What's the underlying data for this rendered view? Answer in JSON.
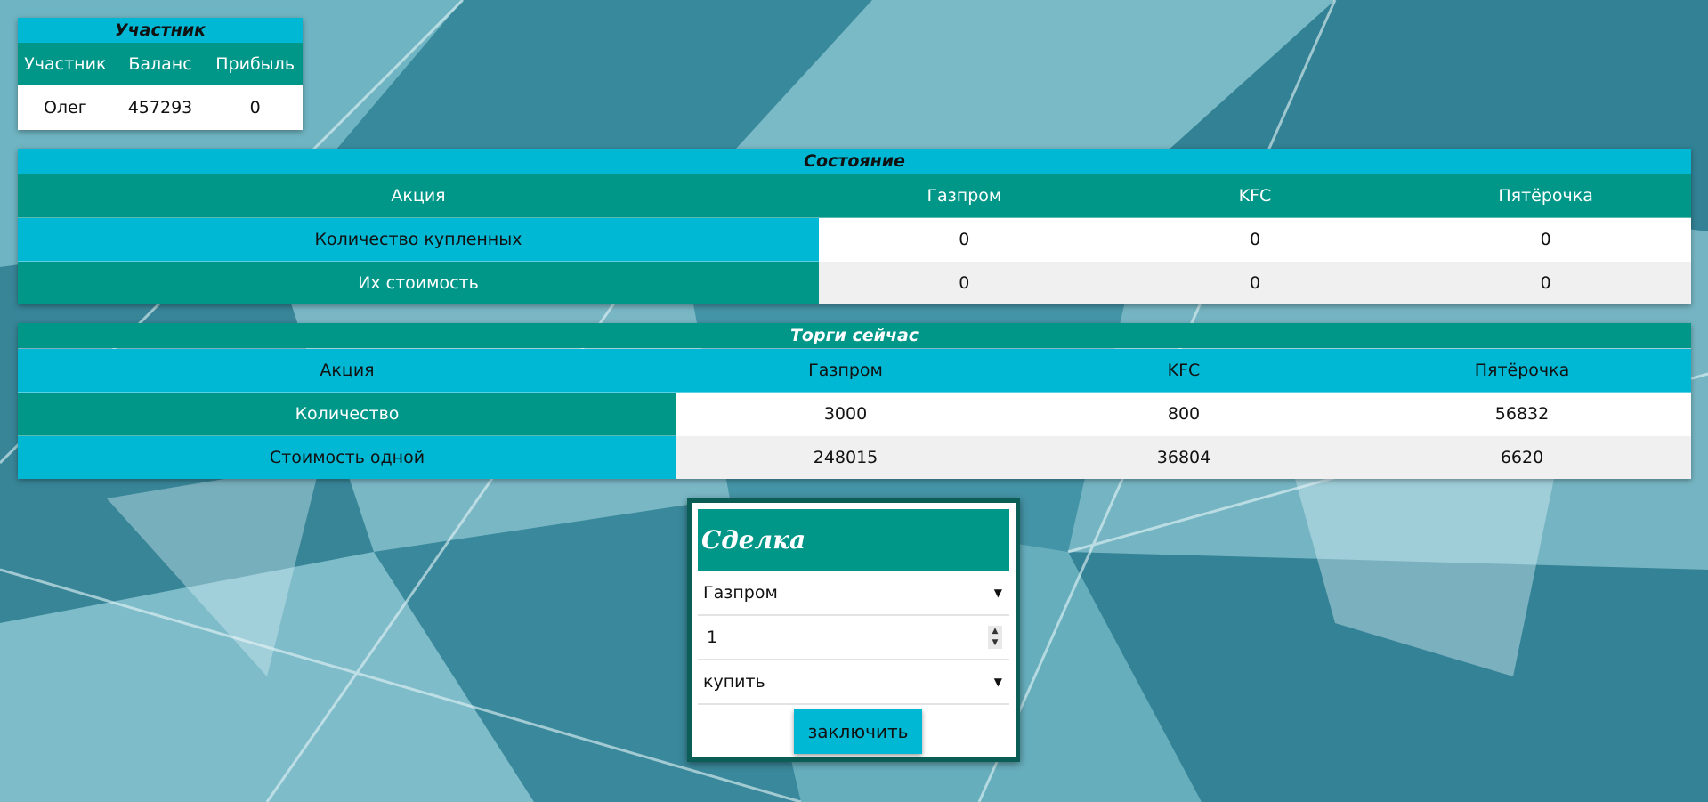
{
  "participant": {
    "title": "Участник",
    "headers": [
      "Участник",
      "Баланс",
      "Прибыль"
    ],
    "values": [
      "Олег",
      "457293",
      "0"
    ]
  },
  "state": {
    "title": "Состояние",
    "headers": [
      "Акция",
      "Газпром",
      "KFC",
      "Пятёрочка"
    ],
    "rows": [
      {
        "label": "Количество купленных",
        "values": [
          "0",
          "0",
          "0"
        ]
      },
      {
        "label": "Их стоимость",
        "values": [
          "0",
          "0",
          "0"
        ]
      }
    ]
  },
  "trading": {
    "title": "Торги сейчас",
    "headers": [
      "Акция",
      "Газпром",
      "KFC",
      "Пятёрочка"
    ],
    "rows": [
      {
        "label": "Количество",
        "values": [
          "3000",
          "800",
          "56832"
        ]
      },
      {
        "label": "Стоимость одной",
        "values": [
          "248015",
          "36804",
          "6620"
        ]
      }
    ]
  },
  "deal": {
    "title": "Сделка",
    "stock_select": "Газпром",
    "quantity": "1",
    "action_select": "купить",
    "submit_label": "заключить"
  },
  "colors": {
    "cyan": "#00b8d4",
    "teal": "#009688",
    "border_dark": "#0b5e56"
  }
}
